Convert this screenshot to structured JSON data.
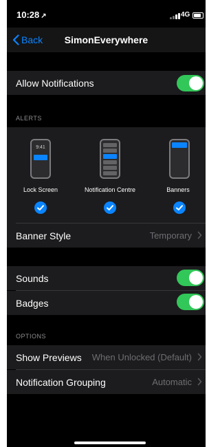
{
  "status_bar": {
    "time": "10:28",
    "location_glyph": "↗",
    "network": "4G"
  },
  "nav": {
    "back_label": "Back",
    "title": "SimonEverywhere"
  },
  "allow_notifications": {
    "label": "Allow Notifications",
    "enabled": true
  },
  "alerts": {
    "header": "ALERTS",
    "lock_time": "9:41",
    "items": [
      {
        "label": "Lock Screen",
        "checked": true
      },
      {
        "label": "Notification Centre",
        "checked": true
      },
      {
        "label": "Banners",
        "checked": true
      }
    ],
    "banner_style": {
      "label": "Banner Style",
      "value": "Temporary"
    }
  },
  "sounds": {
    "label": "Sounds",
    "enabled": true
  },
  "badges": {
    "label": "Badges",
    "enabled": true
  },
  "options": {
    "header": "OPTIONS",
    "show_previews": {
      "label": "Show Previews",
      "value": "When Unlocked (Default)"
    },
    "grouping": {
      "label": "Notification Grouping",
      "value": "Automatic"
    }
  },
  "colors": {
    "accent": "#0a84ff",
    "toggle_on": "#32c759",
    "cell_bg": "#1c1c1e",
    "page_bg": "#000000"
  }
}
